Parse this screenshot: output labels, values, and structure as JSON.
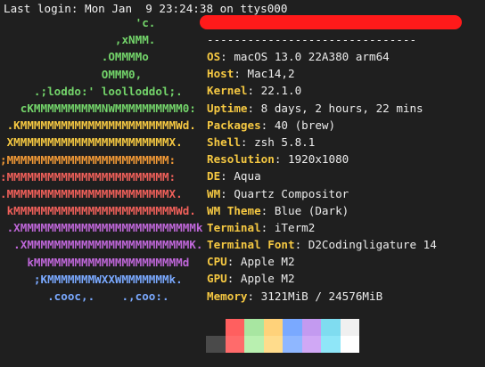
{
  "login_line": "Last login: Mon Jan  9 23:24:38 on ttys000",
  "logo_art": [
    {
      "text": "                    'c.",
      "color": "green"
    },
    {
      "text": "                 ,xNMM.",
      "color": "green"
    },
    {
      "text": "               .OMMMMo",
      "color": "green"
    },
    {
      "text": "               OMMM0,",
      "color": "green"
    },
    {
      "text": "     .;loddo:' loolloddol;.",
      "color": "green"
    },
    {
      "text": "   cKMMMMMMMMMMNWMMMMMMMMMM0:",
      "color": "green"
    },
    {
      "text": " .KMMMMMMMMMMMMMMMMMMMMMMMWd.",
      "color": "yellow"
    },
    {
      "text": " XMMMMMMMMMMMMMMMMMMMMMMMX.",
      "color": "yellow"
    },
    {
      "text": ";MMMMMMMMMMMMMMMMMMMMMMMM:",
      "color": "orange"
    },
    {
      "text": ":MMMMMMMMMMMMMMMMMMMMMMMM:",
      "color": "red"
    },
    {
      "text": ".MMMMMMMMMMMMMMMMMMMMMMMMX.",
      "color": "red"
    },
    {
      "text": " kMMMMMMMMMMMMMMMMMMMMMMMMWd.",
      "color": "red"
    },
    {
      "text": " .XMMMMMMMMMMMMMMMMMMMMMMMMMMk",
      "color": "purple"
    },
    {
      "text": "  .XMMMMMMMMMMMMMMMMMMMMMMMMK.",
      "color": "purple"
    },
    {
      "text": "    kMMMMMMMMMMMMMMMMMMMMMMd",
      "color": "purple"
    },
    {
      "text": "     ;KMMMMMMMWXXWMMMMMMMk.",
      "color": "blue"
    },
    {
      "text": "       .cooc,.    .,coo:.",
      "color": "blue"
    }
  ],
  "separator": "-------------------------------",
  "info": [
    {
      "key": "OS",
      "value": "macOS 13.0 22A380 arm64"
    },
    {
      "key": "Host",
      "value": "Mac14,2"
    },
    {
      "key": "Kernel",
      "value": "22.1.0"
    },
    {
      "key": "Uptime",
      "value": "8 days, 2 hours, 22 mins"
    },
    {
      "key": "Packages",
      "value": "40 (brew)"
    },
    {
      "key": "Shell",
      "value": "zsh 5.8.1"
    },
    {
      "key": "Resolution",
      "value": "1920x1080"
    },
    {
      "key": "DE",
      "value": "Aqua"
    },
    {
      "key": "WM",
      "value": "Quartz Compositor"
    },
    {
      "key": "WM Theme",
      "value": "Blue (Dark)"
    },
    {
      "key": "Terminal",
      "value": "iTerm2"
    },
    {
      "key": "Terminal Font",
      "value": "D2Codingligature 14"
    },
    {
      "key": "CPU",
      "value": "Apple M2"
    },
    {
      "key": "GPU",
      "value": "Apple M2"
    },
    {
      "key": "Memory",
      "value": "3121MiB / 24576MiB"
    }
  ],
  "palette_row1": [
    "#1f1f1f",
    "#ff5f5f",
    "#a8e6a1",
    "#ffd27a",
    "#7aa9ff",
    "#c39af0",
    "#7fdcf0",
    "#f0f0f0"
  ],
  "palette_row2": [
    "#4a4a4a",
    "#ff6b6b",
    "#b9f0b0",
    "#ffdc8c",
    "#8fb7ff",
    "#d0a8f5",
    "#8fe6f8",
    "#ffffff"
  ],
  "colors": {
    "background": "#1f1f1f",
    "key": "#f5c842",
    "redacted_bar": "#ff1a1a",
    "green": "#73d46a",
    "yellow": "#f5c842",
    "orange": "#f39a36",
    "red": "#f0605a",
    "purple": "#bf67d9",
    "blue": "#7aa9ff"
  }
}
